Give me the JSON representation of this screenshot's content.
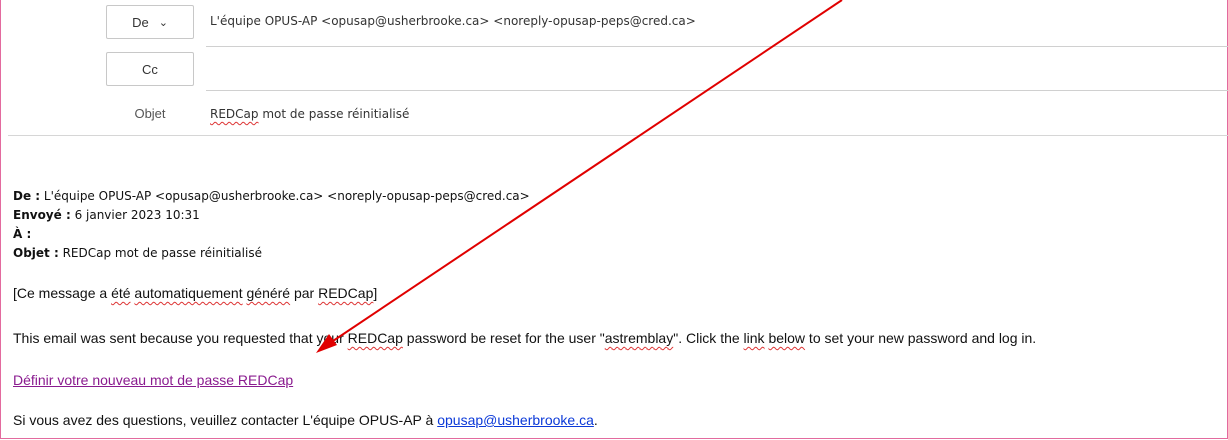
{
  "compose": {
    "from_button": "De",
    "from_value": "L'équipe OPUS-AP <opusap@usherbrooke.ca> <noreply-opusap-peps@cred.ca>",
    "cc_button": "Cc",
    "cc_value": "",
    "subject_label": "Objet",
    "subject_word": "REDCap",
    "subject_rest": " mot de passe réinitialisé"
  },
  "quoted_header": {
    "from_label": "De :",
    "from_value": " L'équipe OPUS-AP <opusap@usherbrooke.ca> <noreply-opusap-peps@cred.ca>",
    "sent_label": "Envoyé :",
    "sent_value": " 6 janvier 2023 10:31",
    "to_label": "À :",
    "subject_label": "Objet :",
    "subject_value": " REDCap mot de passe réinitialisé"
  },
  "message": {
    "auto_p1": "[Ce message a ",
    "auto_w1": "été",
    "auto_p2": " ",
    "auto_w2": "automatiquement",
    "auto_p3": " ",
    "auto_w3": "généré",
    "auto_p4": " par ",
    "auto_w4": "REDCap",
    "auto_p5": "]",
    "reset_p1": "This email was sent because you requested that your ",
    "reset_w1": "REDCap",
    "reset_p2": " password be reset for the user \"",
    "reset_w2": "astremblay",
    "reset_p3": "\". Click the ",
    "reset_w3": "link",
    "reset_p4": " ",
    "reset_w4": "below",
    "reset_p5": " to set your new password and log in.",
    "link_text": "Définir votre nouveau mot de passe REDCap",
    "contact_prefix": "Si vous avez des questions, veuillez contacter L'équipe OPUS-AP à ",
    "contact_email": "opusap@usherbrooke.ca",
    "contact_suffix": "."
  },
  "annotation": {
    "arrow_color": "#e00000"
  }
}
